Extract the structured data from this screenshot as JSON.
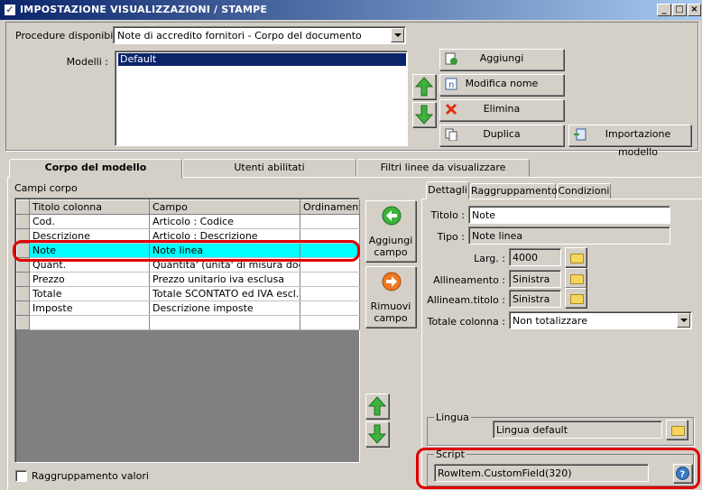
{
  "window": {
    "title": "IMPOSTAZIONE VISUALIZZAZIONI / STAMPE",
    "controls": {
      "minimize": "_",
      "maximize": "□",
      "close": "×"
    }
  },
  "top": {
    "procedure_label": "Procedure disponibili :",
    "procedure_value": "Note di accredito fornitori - Corpo del documento",
    "modelli_label": "Modelli :",
    "modelli_items": [
      "Default"
    ]
  },
  "model_buttons": {
    "aggiungi": "Aggiungi",
    "modifica": "Modifica nome",
    "elimina": "Elimina",
    "duplica": "Duplica",
    "importazione": "Importazione modello"
  },
  "tabs": {
    "corpo": "Corpo del modello",
    "utenti": "Utenti abilitati",
    "filtri": "Filtri linee da visualizzare"
  },
  "campi": {
    "label": "Campi corpo",
    "columns": [
      "Titolo colonna",
      "Campo",
      "Ordinamento"
    ],
    "rows": [
      [
        "Cod.",
        "Articolo : Codice",
        ""
      ],
      [
        "Descrizione",
        "Articolo : Descrizione",
        ""
      ],
      [
        "Note",
        "Note linea",
        ""
      ],
      [
        "Quant.",
        "Quantita' (unita' di misura docum...",
        ""
      ],
      [
        "Prezzo",
        "Prezzo unitario iva esclusa",
        ""
      ],
      [
        "Totale",
        "Totale SCONTATO ed IVA escl...",
        ""
      ],
      [
        "Imposte",
        "Descrizione imposte",
        ""
      ],
      [
        "",
        "",
        ""
      ]
    ],
    "selected_row": 2,
    "aggiungi_campo": [
      "Aggiungi",
      "campo"
    ],
    "rimuovi_campo": [
      "Rimuovi",
      "campo"
    ],
    "raggruppamento_valori": "Raggruppamento valori"
  },
  "detail_tabs": {
    "dettagli": "Dettagli",
    "raggruppamento": "Raggruppamento",
    "condizioni": "Condizioni"
  },
  "detail": {
    "titolo_label": "Titolo :",
    "titolo_value": "Note",
    "tipo_label": "Tipo :",
    "tipo_value": "Note linea",
    "larg_label": "Larg. :",
    "larg_value": "4000",
    "allineamento_label": "Allineamento :",
    "allineamento_value": "Sinistra",
    "allineam_titolo_label": "Allineam.titolo :",
    "allineam_titolo_value": "Sinistra",
    "totale_colonna_label": "Totale colonna :",
    "totale_colonna_value": "Non totalizzare",
    "lingua_label": "Lingua",
    "lingua_value": "Lingua default",
    "script_label": "Script",
    "script_value": "RowItem.CustomField(320)"
  },
  "colors": {
    "title_bar_start": "#0a246a",
    "title_bar_end": "#a6caf0",
    "selection": "#00ffff",
    "highlight_ring": "#e00000",
    "list_selection": "#0a246a"
  }
}
